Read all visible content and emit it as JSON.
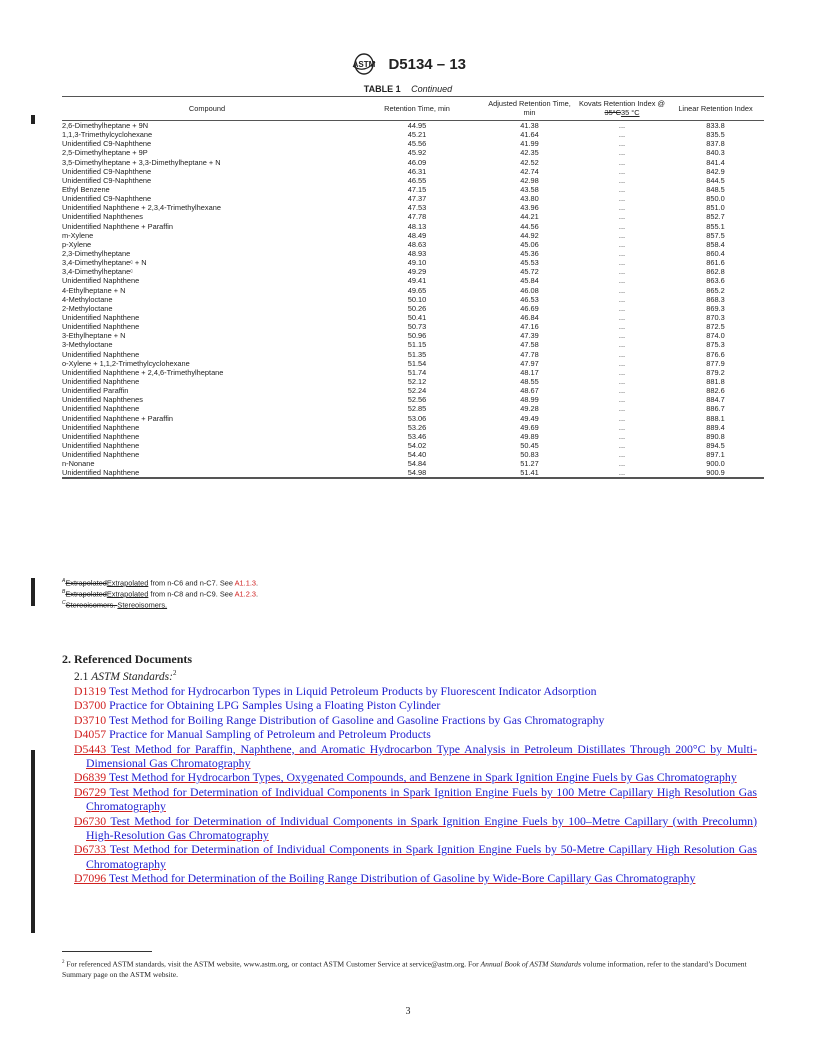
{
  "header": {
    "logo": "ASTM",
    "doc_id": "D5134 – 13"
  },
  "table": {
    "title": "TABLE 1",
    "title_suffix": "Continued",
    "columns": [
      "Compound",
      "Retention Time, min",
      "Adjusted Retention Time, min",
      "Kovats Retention Index @",
      "Linear Retention Index"
    ],
    "kovats_deleted": "35°C",
    "kovats_inserted": "35 °C",
    "rows": [
      [
        "2,6-Dimethylheptane + 9N",
        "44.95",
        "41.38",
        "...",
        "833.8"
      ],
      [
        "1,1,3-Trimethylcyclohexane",
        "45.21",
        "41.64",
        "...",
        "835.5"
      ],
      [
        "Unidentified C9-Naphthene",
        "45.56",
        "41.99",
        "...",
        "837.8"
      ],
      [
        "2,5-Dimethylheptane + 9P",
        "45.92",
        "42.35",
        "...",
        "840.3"
      ],
      [
        "3,5-Dimethylheptane + 3,3-Dimethylheptane +  N",
        "46.09",
        "42.52",
        "...",
        "841.4"
      ],
      [
        "Unidentified C9-Naphthene",
        "46.31",
        "42.74",
        "...",
        "842.9"
      ],
      [
        "Unidentified C9-Naphthene",
        "46.55",
        "42.98",
        "...",
        "844.5"
      ],
      [
        "Ethyl Benzene",
        "47.15",
        "43.58",
        "...",
        "848.5"
      ],
      [
        "Unidentified C9-Naphthene",
        "47.37",
        "43.80",
        "...",
        "850.0"
      ],
      [
        "Unidentified Naphthene + 2,3,4-Trimethylhexane",
        "47.53",
        "43.96",
        "...",
        "851.0"
      ],
      [
        "Unidentified Naphthenes",
        "47.78",
        "44.21",
        "...",
        "852.7"
      ],
      [
        "Unidentified Naphthene + Paraffin",
        "48.13",
        "44.56",
        "...",
        "855.1"
      ],
      [
        "m-Xylene",
        "48.49",
        "44.92",
        "...",
        "857.5"
      ],
      [
        "p-Xylene",
        "48.63",
        "45.06",
        "...",
        "858.4"
      ],
      [
        "2,3-Dimethylheptane",
        "48.93",
        "45.36",
        "...",
        "860.4"
      ],
      [
        "3,4-Dimethylheptaneᶜ + N",
        "49.10",
        "45.53",
        "...",
        "861.6"
      ],
      [
        "3,4-Dimethylheptaneᶜ",
        "49.29",
        "45.72",
        "...",
        "862.8"
      ],
      [
        "Unidentified Naphthene",
        "49.41",
        "45.84",
        "...",
        "863.6"
      ],
      [
        "4-Ethylheptane + N",
        "49.65",
        "46.08",
        "...",
        "865.2"
      ],
      [
        "4-Methyloctane",
        "50.10",
        "46.53",
        "...",
        "868.3"
      ],
      [
        "2-Methyloctane",
        "50.26",
        "46.69",
        "...",
        "869.3"
      ],
      [
        "Unidentified Naphthene",
        "50.41",
        "46.84",
        "...",
        "870.3"
      ],
      [
        "Unidentified Naphthene",
        "50.73",
        "47.16",
        "...",
        "872.5"
      ],
      [
        "3-Ethylheptane + N",
        "50.96",
        "47.39",
        "...",
        "874.0"
      ],
      [
        "3-Methyloctane",
        "51.15",
        "47.58",
        "...",
        "875.3"
      ],
      [
        "Unidentified Naphthene",
        "51.35",
        "47.78",
        "...",
        "876.6"
      ],
      [
        "o-Xylene +  1,1,2-Trimethylcyclohexane",
        "51.54",
        "47.97",
        "...",
        "877.9"
      ],
      [
        "Unidentified Naphthene + 2,4,6-Trimethylheptane",
        "51.74",
        "48.17",
        "...",
        "879.2"
      ],
      [
        "Unidentified Naphthene",
        "52.12",
        "48.55",
        "...",
        "881.8"
      ],
      [
        "Unidentified Paraffin",
        "52.24",
        "48.67",
        "...",
        "882.6"
      ],
      [
        "Unidentified Naphthenes",
        "52.56",
        "48.99",
        "...",
        "884.7"
      ],
      [
        "Unidentified Naphthene",
        "52.85",
        "49.28",
        "...",
        "886.7"
      ],
      [
        "Unidentified Naphthene + Paraffin",
        "53.06",
        "49.49",
        "...",
        "888.1"
      ],
      [
        "Unidentified Naphthene",
        "53.26",
        "49.69",
        "...",
        "889.4"
      ],
      [
        "Unidentified Naphthene",
        "53.46",
        "49.89",
        "...",
        "890.8"
      ],
      [
        "Unidentified Naphthene",
        "54.02",
        "50.45",
        "...",
        "894.5"
      ],
      [
        "Unidentified Naphthene",
        "54.40",
        "50.83",
        "...",
        "897.1"
      ],
      [
        "n-Nonane",
        "54.84",
        "51.27",
        "...",
        "900.0"
      ],
      [
        "Unidentified Naphthene",
        "54.98",
        "51.41",
        "...",
        "900.9"
      ]
    ],
    "footnotes": [
      {
        "mark": "A",
        "deleted": "Extrapolated",
        "inserted": "Extrapolated",
        "text": " from n-C6 and n-C7. See ",
        "link": "A1.1.3",
        "end": "."
      },
      {
        "mark": "B",
        "deleted": "Extrapolated",
        "inserted": "Extrapolated",
        "text": " from n-C8 and n-C9. See ",
        "link": "A1.2.3",
        "end": "."
      },
      {
        "mark": "C",
        "deleted": "Stereoisomers. ",
        "inserted": "Stereoisomers.",
        "text": "",
        "link": "",
        "end": ""
      }
    ]
  },
  "section": {
    "heading": "2.  Referenced Documents",
    "sub_number": "2.1",
    "sub_title": "ASTM Standards:",
    "sub_footnote": "2",
    "references": [
      {
        "code": "D1319",
        "title": "Test Method for Hydrocarbon Types in Liquid Petroleum Products by Fluorescent Indicator Adsorption",
        "new": false
      },
      {
        "code": "D3700",
        "title": "Practice for Obtaining LPG Samples Using a Floating Piston Cylinder",
        "new": false
      },
      {
        "code": "D3710",
        "title": "Test Method for Boiling Range Distribution of Gasoline and Gasoline Fractions by Gas Chromatography",
        "new": false
      },
      {
        "code": "D4057",
        "title": "Practice for Manual Sampling of Petroleum and Petroleum Products",
        "new": false
      },
      {
        "code": "D5443",
        "title": "Test Method for Paraffin, Naphthene, and Aromatic Hydrocarbon Type Analysis in Petroleum Distillates Through 200°C by Multi-Dimensional Gas Chromatography",
        "new": true
      },
      {
        "code": "D6839",
        "title": "Test Method for Hydrocarbon Types, Oxygenated Compounds, and Benzene in Spark Ignition Engine Fuels by Gas Chromatography",
        "new": true
      },
      {
        "code": "D6729",
        "title": "Test Method for Determination of Individual Components in Spark Ignition Engine Fuels by 100 Metre Capillary High Resolution Gas Chromatography",
        "new": true
      },
      {
        "code": "D6730",
        "title": "Test Method for Determination of Individual Components in Spark Ignition Engine Fuels by 100–Metre Capillary (with Precolumn) High-Resolution Gas Chromatography",
        "new": true
      },
      {
        "code": "D6733",
        "title": "Test Method for Determination of Individual Components in Spark Ignition Engine Fuels by 50-Metre Capillary High Resolution Gas Chromatography",
        "new": true
      },
      {
        "code": "D7096",
        "title": "Test Method for Determination of the Boiling Range Distribution of Gasoline by Wide-Bore Capillary Gas Chromatography",
        "new": true
      }
    ]
  },
  "footnote2": {
    "mark": "2",
    "text_before": "For referenced ASTM standards, visit the ASTM website, www.astm.org, or contact ASTM Customer Service at service@astm.org. For ",
    "italic": "Annual Book of ASTM Standards",
    "text_after": " volume information, refer to the standard’s Document Summary page on the ASTM website."
  },
  "page_number": "3",
  "colors": {
    "link_code": "#d02020",
    "link_title": "#1e1ed0",
    "change_bar": "#222222"
  }
}
